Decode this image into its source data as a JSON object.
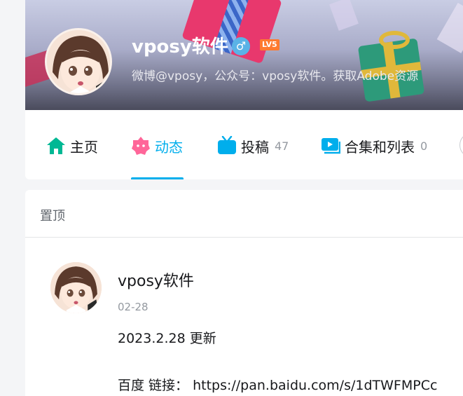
{
  "profile": {
    "name": "vposy软件",
    "gender_symbol": "♂",
    "level": "LV5",
    "sign": "微博@vposy，公众号：vposy软件。获取Adobe资源"
  },
  "nav": {
    "items": [
      {
        "label": "主页",
        "icon": "home-icon",
        "count": ""
      },
      {
        "label": "动态",
        "icon": "dynamic-icon",
        "count": ""
      },
      {
        "label": "投稿",
        "icon": "tv-icon",
        "count": "47"
      },
      {
        "label": "合集和列表",
        "icon": "playlist-icon",
        "count": "0"
      }
    ],
    "active_index": 1
  },
  "feed": {
    "section_title": "置顶",
    "post": {
      "author": "vposy软件",
      "date": "02-28",
      "line1": "2023.2.28 更新",
      "line2": "百度  链接：  https://pan.baidu.com/s/1dTWFMPCc"
    }
  },
  "colors": {
    "accent": "#00aeec",
    "home_icon": "#00b894",
    "dynamic_icon": "#ff6699",
    "tv_icon": "#00aeec",
    "level_badge": "#ff7a2f"
  }
}
